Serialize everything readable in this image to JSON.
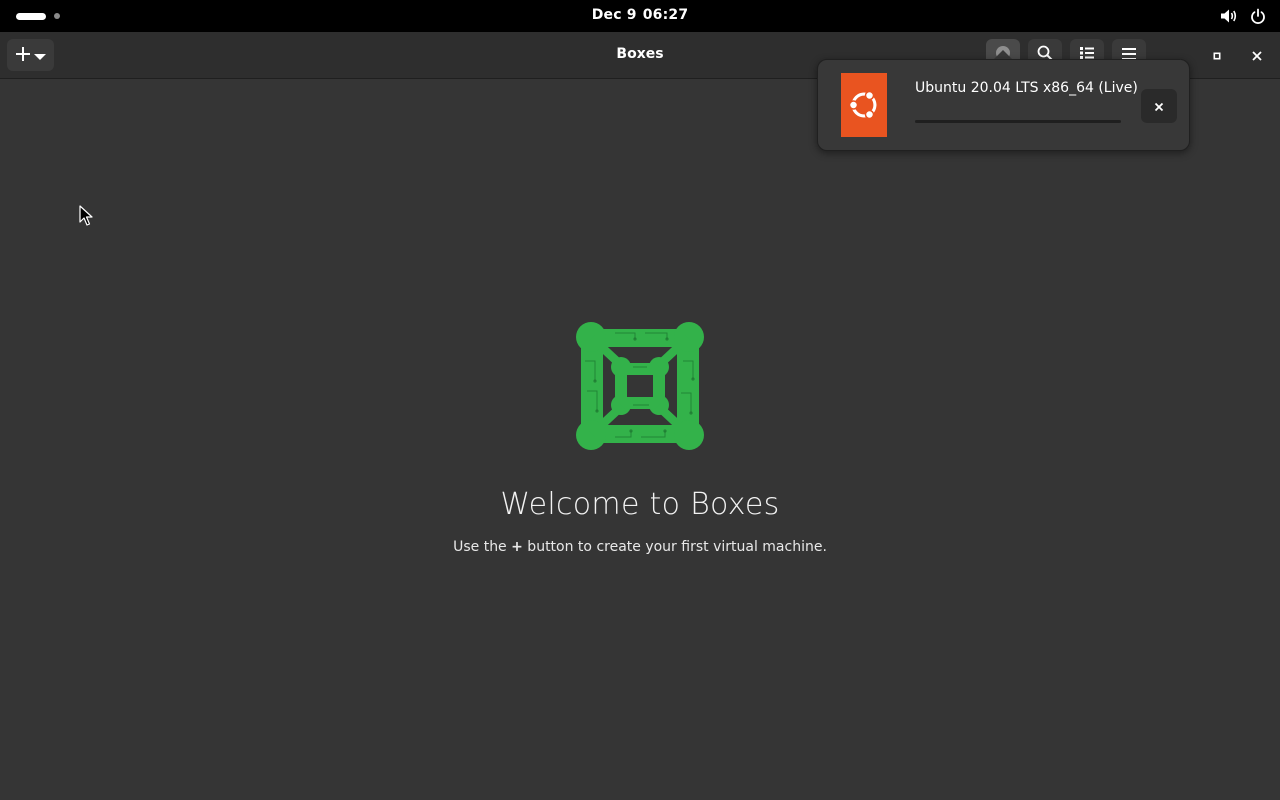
{
  "topbar": {
    "date": "Dec 9",
    "time": "06:27",
    "icons": [
      "activities-indicator",
      "volume-icon",
      "power-icon"
    ]
  },
  "window": {
    "title": "Boxes",
    "headerbar": {
      "new_button_icons": [
        "plus-icon",
        "chevron-down-icon"
      ],
      "right_buttons": [
        "downloads-icon",
        "search-icon",
        "list-view-icon",
        "menu-icon"
      ],
      "window_controls": [
        "minimize-icon",
        "maximize-icon",
        "close-icon"
      ]
    }
  },
  "downloads_popover": {
    "item_title": "Ubuntu 20.04 LTS x86_64 (Live)",
    "progress": 0,
    "icon": "ubuntu-logo-icon",
    "accent_color": "#e95420"
  },
  "empty_state": {
    "heading": "Welcome to Boxes",
    "hint_before": "Use the ",
    "hint_bold": "+",
    "hint_after": " button to create your first virtual machine.",
    "logo": "boxes-logo-icon",
    "logo_color": "#33b24a"
  },
  "colors": {
    "window_bg": "#353535",
    "headerbar_bg": "#2e2e2e",
    "topbar_bg": "#000000",
    "button_bg": "#3a3a3a"
  }
}
